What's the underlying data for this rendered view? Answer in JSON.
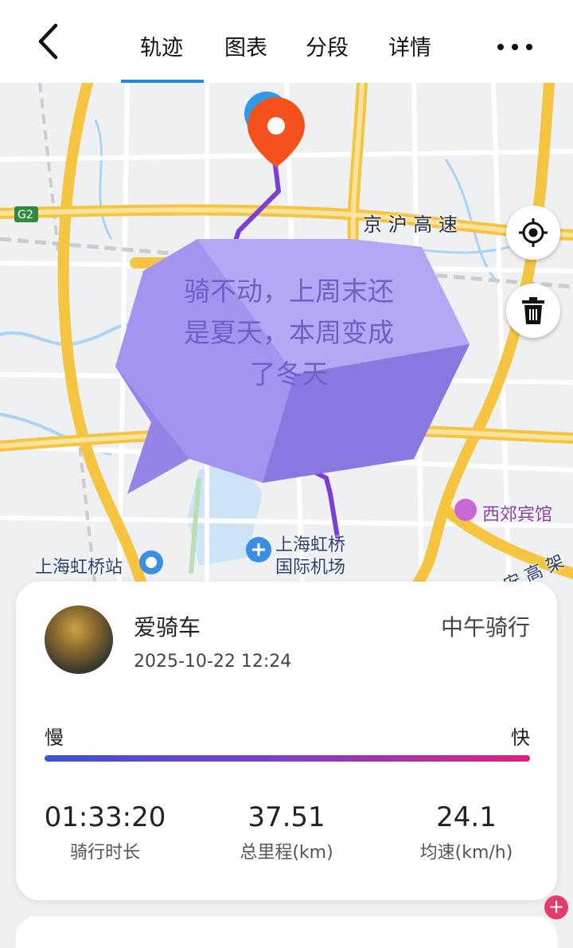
{
  "header": {
    "tabs": [
      {
        "label": "轨迹",
        "active": true
      },
      {
        "label": "图表",
        "active": false
      },
      {
        "label": "分段",
        "active": false
      },
      {
        "label": "详情",
        "active": false
      }
    ],
    "icons": {
      "back": "chevron-left-icon",
      "more": "more-dots-icon"
    }
  },
  "map": {
    "labels": {
      "g2": "G2",
      "expressway": "京 沪 高 速",
      "hotel": "西郊宾馆",
      "station": "上海虹桥站",
      "airport_line1": "上海虹桥",
      "airport_line2": "国际机场",
      "highway_right": "安 高 架"
    },
    "buttons": {
      "locate_icon": "locate-icon",
      "delete_icon": "trash-icon"
    },
    "bubble_text": "骑不动，上周末还是夏天，本周变成了冬天"
  },
  "card": {
    "username": "爱骑车",
    "datetime": "2025-10-22 12:24",
    "activity": "中午骑行",
    "speed_legend": {
      "slow": "慢",
      "fast": "快"
    },
    "stats": [
      {
        "value": "01:33:20",
        "label": "骑行时长"
      },
      {
        "value": "37.51",
        "label": "总里程(km)"
      },
      {
        "value": "24.1",
        "label": "均速(km/h)"
      }
    ]
  },
  "colors": {
    "accent": "#1e88e5",
    "route": "#7c3fd6",
    "pin": "#f4511e",
    "bubble": "#a394f0"
  }
}
